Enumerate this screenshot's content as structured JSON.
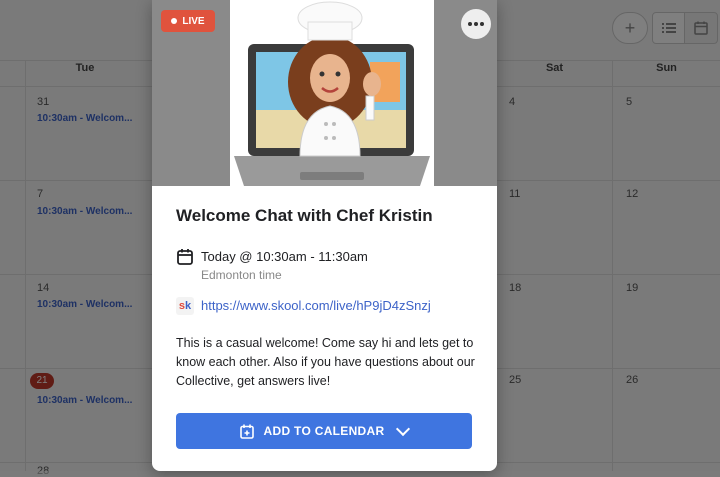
{
  "toolbar": {
    "add_icon": "+",
    "list_icon": "list-icon",
    "calendar_icon": "calendar-icon"
  },
  "calendar": {
    "day_headers": [
      "Tue",
      "Sat",
      "Sun"
    ],
    "rows": [
      {
        "tue": "31",
        "sat": "4",
        "sun": "5",
        "event": "10:30am - Welcom..."
      },
      {
        "tue": "7",
        "sat": "11",
        "sun": "12",
        "event": "10:30am - Welcom..."
      },
      {
        "tue": "14",
        "sat": "18",
        "sun": "19",
        "event": "10:30am - Welcom..."
      },
      {
        "tue": "21",
        "sat": "25",
        "sun": "26",
        "event": "10:30am - Welcom..."
      }
    ],
    "partial_next": "28"
  },
  "modal": {
    "live_label": "LIVE",
    "title": "Welcome Chat with Chef Kristin",
    "when": "Today @ 10:30am - 11:30am",
    "timezone": "Edmonton time",
    "link_logo": "sk",
    "link": "https://www.skool.com/live/hP9jD4zSnzj",
    "description": "This is a casual welcome! Come say hi and lets get to know each other. Also if you have questions about our Collective, get answers live!",
    "add_button": "ADD TO CALENDAR",
    "colors": {
      "live": "#e0533d",
      "primary": "#3f75e0",
      "link": "#3d63c8"
    }
  }
}
